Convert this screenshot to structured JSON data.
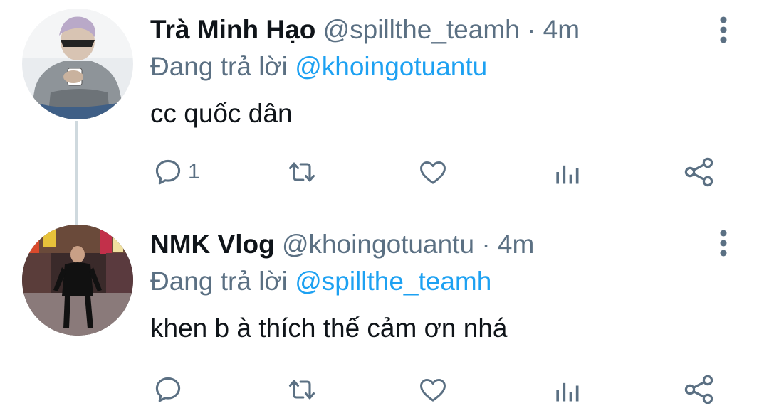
{
  "tweets": [
    {
      "name": "Trà Minh Hạo",
      "handle": "@spillthe_teamh",
      "dot": "·",
      "time": "4m",
      "replying_prefix": "Đang trả lời",
      "replying_to": "@khoingotuantu",
      "text": "cc quốc dân",
      "reply_count": "1",
      "avatar_icon": "avatar-hoodie-sunglasses"
    },
    {
      "name": "NMK Vlog",
      "handle": "@khoingotuantu",
      "dot": "·",
      "time": "4m",
      "replying_prefix": "Đang trả lời",
      "replying_to": "@spillthe_teamh",
      "text": "khen b à thích thế cảm ơn nhá",
      "reply_count": "",
      "avatar_icon": "avatar-street-night"
    }
  ],
  "icons": {
    "reply": "reply-icon",
    "retweet": "retweet-icon",
    "like": "heart-icon",
    "analytics": "analytics-icon",
    "share": "share-icon",
    "more": "more-vertical-icon"
  },
  "colors": {
    "text": "#0f1419",
    "secondary": "#5b7083",
    "accent": "#1da1f2",
    "thread_line": "#cfd9de"
  }
}
